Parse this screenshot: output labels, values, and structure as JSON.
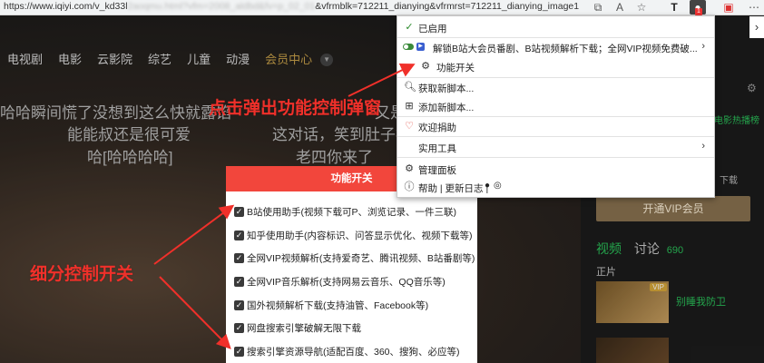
{
  "browser": {
    "url_visible": "https://www.iqiyi.com/v_kd33l",
    "url_blurred": "2aoqmu.html?vfm=2008_aldbd&fv=p_02_01",
    "url_tail": "&vfrmblk=712211_dianying&vfrmrst=712211_dianying_image1",
    "icons": [
      "share-icon",
      "read-aloud-icon",
      "favorite-icon",
      "t-extension-icon",
      "tampermonkey-icon",
      "extension-icon",
      "more-icon"
    ],
    "ext_badge": "1"
  },
  "site": {
    "nav": [
      "电视剧",
      "电影",
      "云影院",
      "综艺",
      "儿童",
      "动漫",
      "会员中心"
    ],
    "subtitle_lines": [
      "哈哈瞬间慌了没想到这么快就露馅",
      "能能叔还是很可爱",
      "哈[哈哈哈哈]",
      "又是",
      "这对话，笑到肚子疼",
      "老四你来了"
    ],
    "vip_button": "开通VIP会员",
    "side_tab_video": "视频",
    "side_tab_discuss": "讨论",
    "discuss_count": "690",
    "zhengpian": "正片",
    "vip_tag": "VIP",
    "thumb_title": "别睡我防卫",
    "side_note": "电影热播榜",
    "side_download": "下载"
  },
  "modal": {
    "title": "功能开关",
    "options": [
      "B站使用助手(视频下载可P、浏览记录、一件三联)",
      "知乎使用助手(内容标识、问答显示优化、视频下载等)",
      "全网VIP视频解析(支持爱奇艺、腾讯视频、B站番剧等)",
      "全网VIP音乐解析(支持网易云音乐、QQ音乐等)",
      "国外视频解析下载(支持油管、Facebook等)",
      "网盘搜索引擎破解无限下载",
      "搜索引擎资源导航(适配百度、360、搜狗、必应等)"
    ]
  },
  "menu": {
    "enabled": "已启用",
    "script_title": "解锁B站大会员番剧、B站视频解析下载；全网VIP视频免费破...",
    "feature_toggle": "功能开关",
    "get_scripts": "获取新脚本...",
    "add_script": "添加新脚本...",
    "donate": "欢迎捐助",
    "tools": "实用工具",
    "dashboard": "管理面板",
    "help": "帮助 | 更新日志 | "
  },
  "annotations": {
    "top": "点击弹出功能控制弹窗",
    "left": "细分控制开关"
  },
  "colors": {
    "accent_red": "#f2463c",
    "annotation_red": "#f0302a",
    "iqiyi_green": "#2bc25a",
    "vip_gold": "#c9a24a"
  }
}
